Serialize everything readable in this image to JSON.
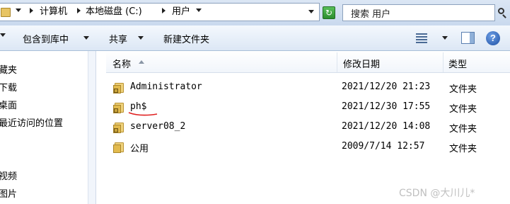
{
  "address": {
    "crumbs": [
      "计算机",
      "本地磁盘 (C:)",
      "用户"
    ],
    "search_placeholder": "搜索 用户"
  },
  "toolbar": {
    "include_library": "包含到库中",
    "share": "共享",
    "new_folder": "新建文件夹"
  },
  "nav": {
    "items": [
      "藏夹",
      "下载",
      "桌面",
      "最近访问的位置",
      "视频",
      "图片"
    ]
  },
  "columns": {
    "name": "名称",
    "modified": "修改日期",
    "type": "类型"
  },
  "files": [
    {
      "name": "Administrator",
      "modified": "2021/12/20 21:23",
      "type": "文件夹",
      "locked": true
    },
    {
      "name": "ph$",
      "modified": "2021/12/30 17:55",
      "type": "文件夹",
      "locked": true
    },
    {
      "name": "server08_2",
      "modified": "2021/12/20 14:08",
      "type": "文件夹",
      "locked": true
    },
    {
      "name": "公用",
      "modified": "2009/7/14 12:57",
      "type": "文件夹",
      "locked": false
    }
  ],
  "watermark": "CSDN @大川儿*",
  "colors": {
    "annotation_underline": "#e02020",
    "folder": "#e2ba4d",
    "chrome": "#dce7f5"
  }
}
